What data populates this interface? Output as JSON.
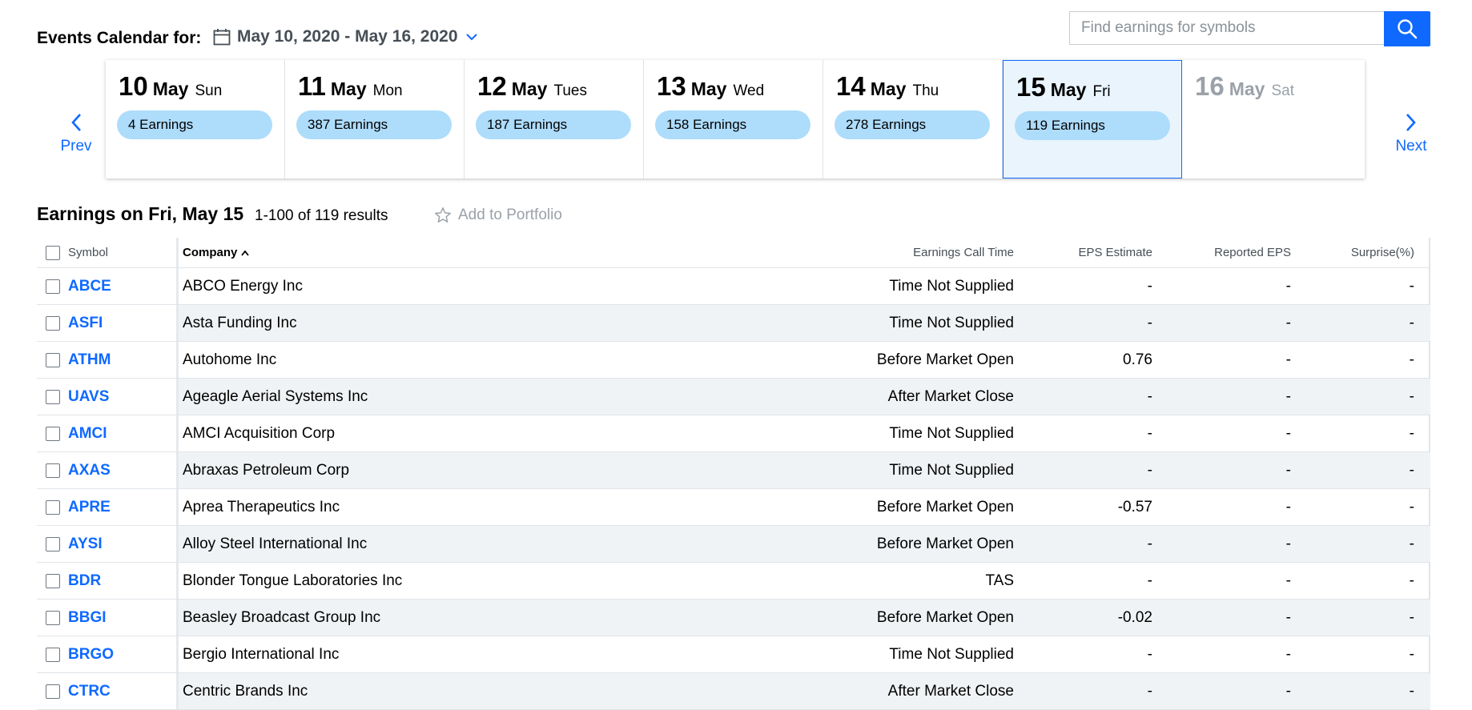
{
  "header": {
    "title": "Events Calendar for:",
    "date_range": "May 10, 2020 - May 16, 2020",
    "search_placeholder": "Find earnings for symbols"
  },
  "nav": {
    "prev": "Prev",
    "next": "Next"
  },
  "days": [
    {
      "num": "10",
      "month": "May",
      "weekday": "Sun",
      "earnings": "4 Earnings"
    },
    {
      "num": "11",
      "month": "May",
      "weekday": "Mon",
      "earnings": "387 Earnings"
    },
    {
      "num": "12",
      "month": "May",
      "weekday": "Tues",
      "earnings": "187 Earnings"
    },
    {
      "num": "13",
      "month": "May",
      "weekday": "Wed",
      "earnings": "158 Earnings"
    },
    {
      "num": "14",
      "month": "May",
      "weekday": "Thu",
      "earnings": "278 Earnings"
    },
    {
      "num": "15",
      "month": "May",
      "weekday": "Fri",
      "earnings": "119 Earnings"
    },
    {
      "num": "16",
      "month": "May",
      "weekday": "Sat",
      "earnings": ""
    }
  ],
  "results": {
    "title": "Earnings on Fri, May 15",
    "count": "1-100 of 119 results",
    "add_to_portfolio": "Add to Portfolio"
  },
  "table": {
    "headers": {
      "symbol": "Symbol",
      "company": "Company",
      "call_time": "Earnings Call Time",
      "eps_estimate": "EPS Estimate",
      "reported_eps": "Reported EPS",
      "surprise": "Surprise(%)"
    },
    "rows": [
      {
        "symbol": "ABCE",
        "company": "ABCO Energy Inc",
        "call_time": "Time Not Supplied",
        "eps": "-",
        "reported": "-",
        "surprise": "-"
      },
      {
        "symbol": "ASFI",
        "company": "Asta Funding Inc",
        "call_time": "Time Not Supplied",
        "eps": "-",
        "reported": "-",
        "surprise": "-"
      },
      {
        "symbol": "ATHM",
        "company": "Autohome Inc",
        "call_time": "Before Market Open",
        "eps": "0.76",
        "reported": "-",
        "surprise": "-"
      },
      {
        "symbol": "UAVS",
        "company": "Ageagle Aerial Systems Inc",
        "call_time": "After Market Close",
        "eps": "-",
        "reported": "-",
        "surprise": "-"
      },
      {
        "symbol": "AMCI",
        "company": "AMCI Acquisition Corp",
        "call_time": "Time Not Supplied",
        "eps": "-",
        "reported": "-",
        "surprise": "-"
      },
      {
        "symbol": "AXAS",
        "company": "Abraxas Petroleum Corp",
        "call_time": "Time Not Supplied",
        "eps": "-",
        "reported": "-",
        "surprise": "-"
      },
      {
        "symbol": "APRE",
        "company": "Aprea Therapeutics Inc",
        "call_time": "Before Market Open",
        "eps": "-0.57",
        "reported": "-",
        "surprise": "-"
      },
      {
        "symbol": "AYSI",
        "company": "Alloy Steel International Inc",
        "call_time": "Before Market Open",
        "eps": "-",
        "reported": "-",
        "surprise": "-"
      },
      {
        "symbol": "BDR",
        "company": "Blonder Tongue Laboratories Inc",
        "call_time": "TAS",
        "eps": "-",
        "reported": "-",
        "surprise": "-"
      },
      {
        "symbol": "BBGI",
        "company": "Beasley Broadcast Group Inc",
        "call_time": "Before Market Open",
        "eps": "-0.02",
        "reported": "-",
        "surprise": "-"
      },
      {
        "symbol": "BRGO",
        "company": "Bergio International Inc",
        "call_time": "Time Not Supplied",
        "eps": "-",
        "reported": "-",
        "surprise": "-"
      },
      {
        "symbol": "CTRC",
        "company": "Centric Brands Inc",
        "call_time": "After Market Close",
        "eps": "-",
        "reported": "-",
        "surprise": "-"
      }
    ]
  }
}
